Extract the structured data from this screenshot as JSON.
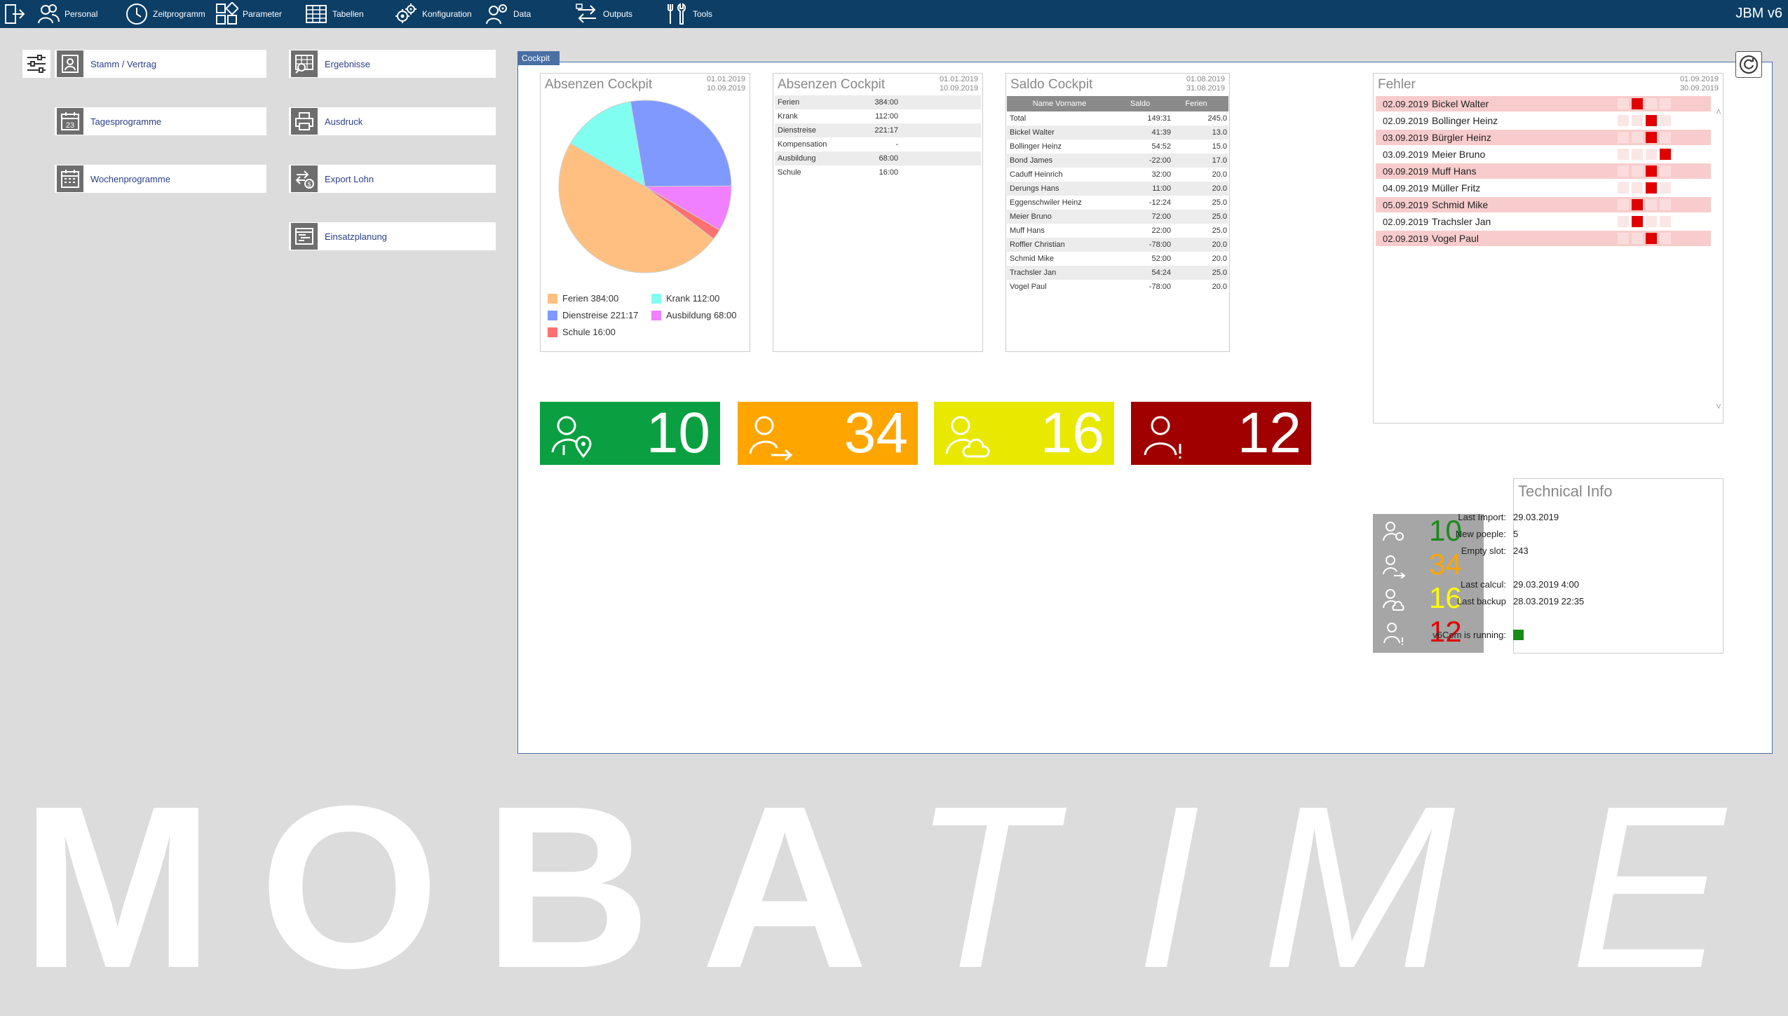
{
  "toolbar": {
    "items": [
      {
        "label": ""
      },
      {
        "label": "Personal"
      },
      {
        "label": "Zeitprogramm"
      },
      {
        "label": "Parameter"
      },
      {
        "label": "Tabellen"
      },
      {
        "label": "Konfiguration"
      },
      {
        "label": "Data"
      },
      {
        "label": "Outputs"
      },
      {
        "label": "Tools"
      }
    ],
    "app_title": "JBM v6"
  },
  "launcher": {
    "col1": [
      "Stamm / Vertrag",
      "Tagesprogramme",
      "Wochenprogramme"
    ],
    "col2": [
      "Ergebnisse",
      "Ausdruck",
      "Export Lohn",
      "Einsatzplanung"
    ]
  },
  "cockpit": {
    "tab_label": "Cockpit",
    "absenzen_chart": {
      "title": "Absenzen Cockpit",
      "date_from": "01.01.2019",
      "date_to": "10.09.2019",
      "legend": [
        {
          "label": "Ferien 384:00",
          "color": "#ffbf80"
        },
        {
          "label": "Krank 112:00",
          "color": "#80fff0"
        },
        {
          "label": "Dienstreise 221:17",
          "color": "#8099ff"
        },
        {
          "label": "Ausbildung 68:00",
          "color": "#f080ff"
        },
        {
          "label": "Schule 16:00",
          "color": "#ff7070"
        }
      ]
    },
    "absenzen_table": {
      "title": "Absenzen Cockpit",
      "date_from": "01.01.2019",
      "date_to": "10.09.2019",
      "rows": [
        {
          "name": "Ferien",
          "value": "384:00"
        },
        {
          "name": "Krank",
          "value": "112:00"
        },
        {
          "name": "Dienstreise",
          "value": "221:17"
        },
        {
          "name": "Kompensation",
          "value": "-"
        },
        {
          "name": "Ausbildung",
          "value": "68:00"
        },
        {
          "name": "Schule",
          "value": "16:00"
        }
      ]
    },
    "saldo": {
      "title": "Saldo Cockpit",
      "date_from": "01.08.2019",
      "date_to": "31.08.2019",
      "headers": [
        "Name Vorname",
        "Saldo",
        "Ferien"
      ],
      "rows": [
        [
          "Total",
          "149:31",
          "245.0"
        ],
        [
          "Bickel Walter",
          "41:39",
          "13.0"
        ],
        [
          "Bollinger Heinz",
          "54:52",
          "15.0"
        ],
        [
          "Bond James",
          "-22:00",
          "17.0"
        ],
        [
          "Caduff Heinrich",
          "32:00",
          "20.0"
        ],
        [
          "Derungs Hans",
          "11:00",
          "20.0"
        ],
        [
          "Eggenschwiler Heinz",
          "-12:24",
          "25.0"
        ],
        [
          "Meier Bruno",
          "72:00",
          "25.0"
        ],
        [
          "Muff Hans",
          "22:00",
          "25.0"
        ],
        [
          "Roffler Christian",
          "-78:00",
          "20.0"
        ],
        [
          "Schmid Mike",
          "52:00",
          "20.0"
        ],
        [
          "Trachsler Jan",
          "54:24",
          "25.0"
        ],
        [
          "Vogel Paul",
          "-78:00",
          "20.0"
        ]
      ]
    },
    "fehler": {
      "title": "Fehler",
      "date_from": "01.09.2019",
      "date_to": "30.09.2019",
      "rows": [
        {
          "date": "02.09.2019",
          "name": "Bickel Walter",
          "highlight": true,
          "mark": 1
        },
        {
          "date": "02.09.2019",
          "name": "Bollinger Heinz",
          "highlight": false,
          "mark": 2
        },
        {
          "date": "03.09.2019",
          "name": "Bürgler Heinz",
          "highlight": true,
          "mark": 2
        },
        {
          "date": "03.09.2019",
          "name": "Meier Bruno",
          "highlight": false,
          "mark": 3
        },
        {
          "date": "09.09.2019",
          "name": "Muff Hans",
          "highlight": true,
          "mark": 2
        },
        {
          "date": "04.09.2019",
          "name": "Müller Fritz",
          "highlight": false,
          "mark": 2
        },
        {
          "date": "05.09.2019",
          "name": "Schmid Mike",
          "highlight": true,
          "mark": 1
        },
        {
          "date": "02.09.2019",
          "name": "Trachsler Jan",
          "highlight": false,
          "mark": 1
        },
        {
          "date": "02.09.2019",
          "name": "Vogel Paul",
          "highlight": true,
          "mark": 2
        }
      ]
    },
    "kpis": [
      {
        "value": "10",
        "color": "#0aa041",
        "icon": "person-location-icon"
      },
      {
        "value": "34",
        "color": "#ffa500",
        "icon": "person-arrow-icon"
      },
      {
        "value": "16",
        "color": "#e8e800",
        "icon": "person-cloud-icon"
      },
      {
        "value": "12",
        "color": "#a00000",
        "icon": "person-alert-icon"
      }
    ],
    "summary": [
      {
        "value": "10",
        "color": "#1a8a1a"
      },
      {
        "value": "34",
        "color": "#ffa500"
      },
      {
        "value": "16",
        "color": "#ffff00"
      },
      {
        "value": "12",
        "color": "#e00000"
      }
    ],
    "technical_info": {
      "title": "Technical Info",
      "last_import_label": "Last Import:",
      "last_import": "29.03.2019",
      "new_people_label": "New poeple:",
      "new_people": "5",
      "empty_slot_label": "Empty slot:",
      "empty_slot": "243",
      "last_calcul_label": "Last calcul:",
      "last_calcul": "29.03.2019 4:00",
      "last_backup_label": "Last backup",
      "last_backup": "28.03.2019 22:35",
      "v6com_label": "v6Com is running:",
      "v6com_color": "#1a8a1a"
    }
  },
  "watermark": {
    "letters": [
      "M",
      "O",
      "B",
      "A",
      "T",
      "I",
      "M",
      "E"
    ]
  }
}
